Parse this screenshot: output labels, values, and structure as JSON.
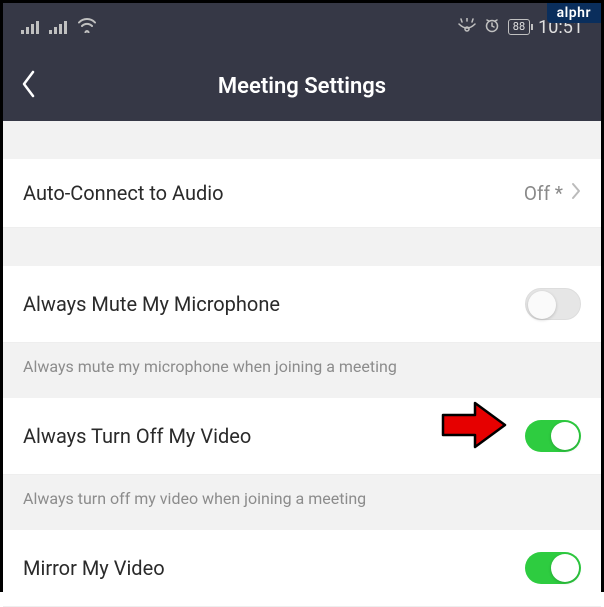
{
  "badge": "alphr",
  "status": {
    "battery": "88",
    "time": "10:51"
  },
  "header": {
    "title": "Meeting Settings"
  },
  "settings": {
    "autoConnect": {
      "label": "Auto-Connect to Audio",
      "value": "Off *"
    },
    "muteMic": {
      "label": "Always Mute My Microphone",
      "description": "Always mute my microphone when joining a meeting",
      "on": false
    },
    "turnOffVideo": {
      "label": "Always Turn Off My Video",
      "description": "Always turn off my video when joining a meeting",
      "on": true
    },
    "mirrorVideo": {
      "label": "Mirror My Video",
      "on": true
    }
  }
}
